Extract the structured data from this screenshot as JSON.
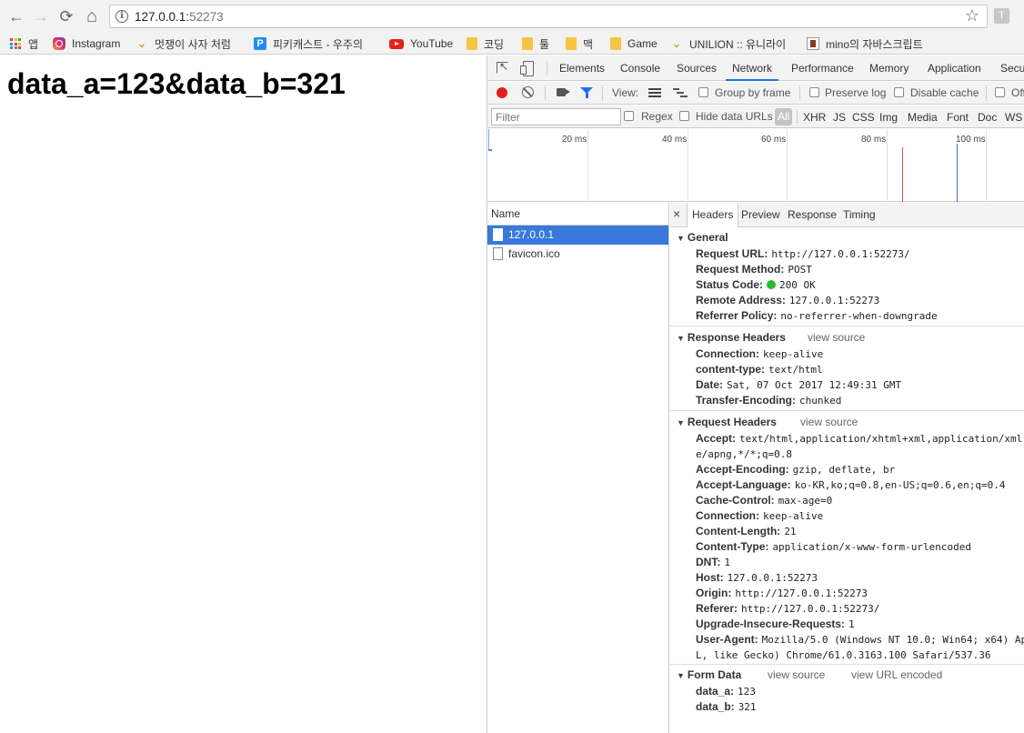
{
  "browser": {
    "url_host": "127.0.0.1:",
    "url_port": "52273",
    "profile_initial": "T",
    "icons": {
      "back": "←",
      "forward": "→",
      "reload": "⟳",
      "home": "⌂",
      "info": "i",
      "star": "☆"
    }
  },
  "bookmarks": [
    {
      "label": "앱",
      "icon": "apps-icon"
    },
    {
      "label": "Instagram",
      "icon": "instagram-icon"
    },
    {
      "label": "멋쟁이 사자 처럼",
      "icon": "lion-icon"
    },
    {
      "label": "피키캐스트 - 우주의",
      "icon": "pikicast-icon"
    },
    {
      "label": "YouTube",
      "icon": "youtube-icon"
    },
    {
      "label": "코딩",
      "icon": "folder-icon"
    },
    {
      "label": "툴",
      "icon": "folder-icon"
    },
    {
      "label": "맥",
      "icon": "folder-icon"
    },
    {
      "label": "Game",
      "icon": "folder-icon"
    },
    {
      "label": "UNILION :: 유니라이",
      "icon": "lion-icon"
    },
    {
      "label": "mino의 자바스크립트",
      "icon": "book-icon"
    }
  ],
  "page": {
    "text": "data_a=123&data_b=321"
  },
  "devtools": {
    "tabs": [
      "Elements",
      "Console",
      "Sources",
      "Network",
      "Performance",
      "Memory",
      "Application",
      "Secu"
    ],
    "active_tab": "Network",
    "toolbar": {
      "view_label": "View:",
      "group_by_frame": "Group by frame",
      "preserve_log": "Preserve log",
      "disable_cache": "Disable cache",
      "offline": "Off"
    },
    "filter": {
      "placeholder": "Filter",
      "regex": "Regex",
      "hide_data_urls": "Hide data URLs",
      "types": [
        "All",
        "XHR",
        "JS",
        "CSS",
        "Img",
        "Media",
        "Font",
        "Doc",
        "WS"
      ]
    },
    "timeline_ticks": [
      "20 ms",
      "40 ms",
      "60 ms",
      "80 ms",
      "100 ms"
    ],
    "name_header": "Name",
    "requests": [
      "127.0.0.1",
      "favicon.ico"
    ],
    "detail_tabs": [
      "Headers",
      "Preview",
      "Response",
      "Timing"
    ],
    "close_glyph": "×",
    "general": {
      "title": "General",
      "rows": [
        {
          "k": "Request URL:",
          "v": "http://127.0.0.1:52273/"
        },
        {
          "k": "Request Method:",
          "v": "POST"
        },
        {
          "k": "Status Code:",
          "v": "200 OK"
        },
        {
          "k": "Remote Address:",
          "v": "127.0.0.1:52273"
        },
        {
          "k": "Referrer Policy:",
          "v": "no-referrer-when-downgrade"
        }
      ]
    },
    "response_headers": {
      "title": "Response Headers",
      "link": "view source",
      "rows": [
        {
          "k": "Connection:",
          "v": "keep-alive"
        },
        {
          "k": "content-type:",
          "v": "text/html"
        },
        {
          "k": "Date:",
          "v": "Sat, 07 Oct 2017 12:49:31 GMT"
        },
        {
          "k": "Transfer-Encoding:",
          "v": "chunked"
        }
      ]
    },
    "request_headers": {
      "title": "Request Headers",
      "link": "view source",
      "accept": {
        "k": "Accept:",
        "v": "text/html,application/xhtml+xml,application/xml;",
        "cont": "e/apng,*/*;q=0.8"
      },
      "rows": [
        {
          "k": "Accept-Encoding:",
          "v": "gzip, deflate, br"
        },
        {
          "k": "Accept-Language:",
          "v": "ko-KR,ko;q=0.8,en-US;q=0.6,en;q=0.4"
        },
        {
          "k": "Cache-Control:",
          "v": "max-age=0"
        },
        {
          "k": "Connection:",
          "v": "keep-alive"
        },
        {
          "k": "Content-Length:",
          "v": "21"
        },
        {
          "k": "Content-Type:",
          "v": "application/x-www-form-urlencoded"
        },
        {
          "k": "DNT:",
          "v": "1"
        },
        {
          "k": "Host:",
          "v": "127.0.0.1:52273"
        },
        {
          "k": "Origin:",
          "v": "http://127.0.0.1:52273"
        },
        {
          "k": "Referer:",
          "v": "http://127.0.0.1:52273/"
        },
        {
          "k": "Upgrade-Insecure-Requests:",
          "v": "1"
        }
      ],
      "user_agent": {
        "k": "User-Agent:",
        "v": "Mozilla/5.0 (Windows NT 10.0; Win64; x64) Ap",
        "cont": "L, like Gecko) Chrome/61.0.3163.100 Safari/537.36"
      }
    },
    "form_data": {
      "title": "Form Data",
      "link_source": "view source",
      "link_encoded": "view URL encoded",
      "rows": [
        {
          "k": "data_a:",
          "v": "123"
        },
        {
          "k": "data_b:",
          "v": "321"
        }
      ]
    }
  }
}
